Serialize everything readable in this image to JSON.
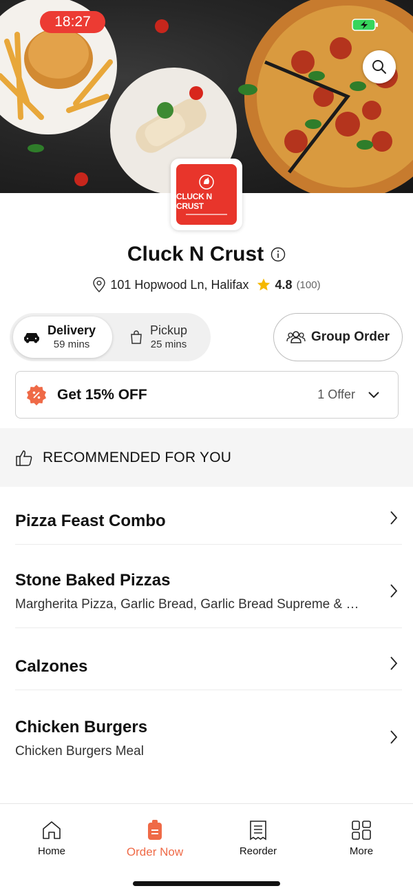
{
  "status": {
    "time": "18:27"
  },
  "restaurant": {
    "name": "Cluck N Crust",
    "logo_text": "CLUCK N CRUST",
    "address": "101 Hopwood Ln, Halifax",
    "rating": "4.8",
    "rating_count": "(100)"
  },
  "modes": [
    {
      "label": "Delivery",
      "time": "59 mins",
      "selected": true
    },
    {
      "label": "Pickup",
      "time": "25 mins",
      "selected": false
    }
  ],
  "group_order_label": "Group Order",
  "offer": {
    "title": "Get 15% OFF",
    "count": "1 Offer"
  },
  "section_title": "RECOMMENDED FOR YOU",
  "categories": [
    {
      "name": "Pizza Feast Combo",
      "desc": ""
    },
    {
      "name": "Stone Baked Pizzas",
      "desc": "Margherita Pizza, Garlic Bread, Garlic Bread Supreme & Pepperoni Pizza"
    },
    {
      "name": "Calzones",
      "desc": ""
    },
    {
      "name": "Chicken Burgers",
      "desc": "Chicken Burgers Meal"
    }
  ],
  "nav": [
    {
      "label": "Home",
      "icon": "home-icon"
    },
    {
      "label": "Order Now",
      "icon": "order-bag-icon",
      "active": true
    },
    {
      "label": "Reorder",
      "icon": "receipt-icon"
    },
    {
      "label": "More",
      "icon": "grid-icon"
    }
  ],
  "colors": {
    "accent": "#ef6a47",
    "brand_red": "#e8352b",
    "star": "#f5b800"
  }
}
